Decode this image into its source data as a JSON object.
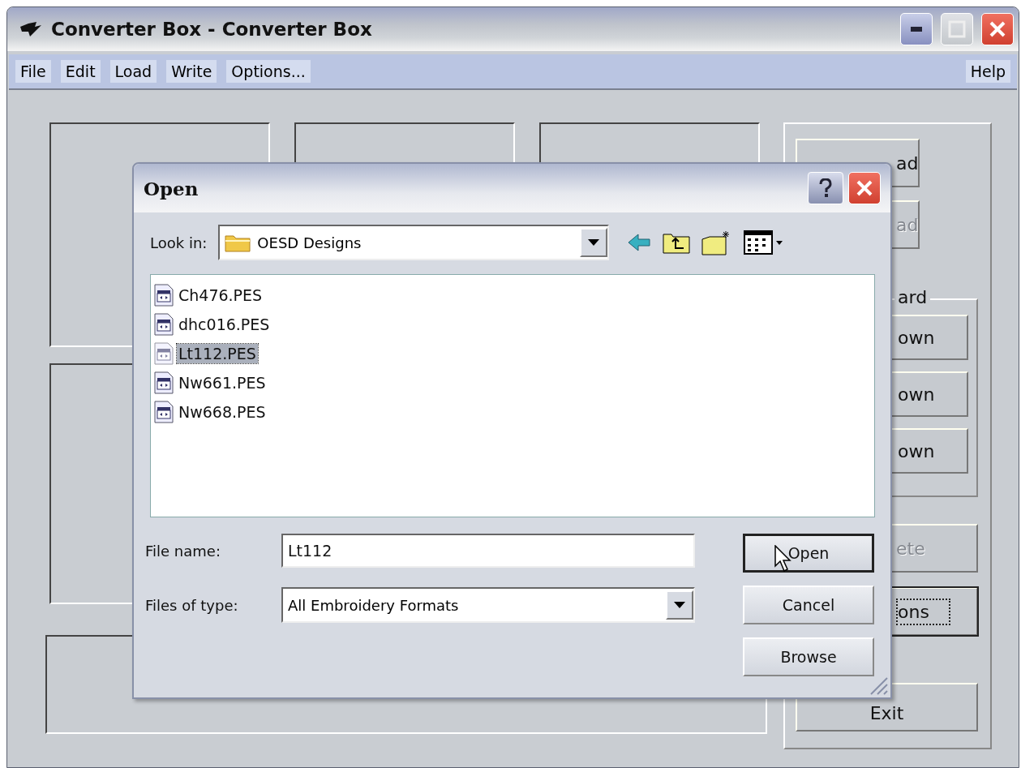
{
  "window": {
    "title": "Converter Box - Converter Box"
  },
  "menu": [
    {
      "label": "File"
    },
    {
      "label": "Edit"
    },
    {
      "label": "Load"
    },
    {
      "label": "Write"
    },
    {
      "label": "Options..."
    }
  ],
  "help_menu": {
    "label": "Help"
  },
  "side_buttons_top": [
    {
      "label": "ad",
      "disabled": false
    },
    {
      "label": "ad",
      "disabled": true
    }
  ],
  "group": {
    "label": "ard",
    "buttons": [
      {
        "label": "own",
        "disabled": false
      },
      {
        "label": "own",
        "disabled": false
      },
      {
        "label": "own",
        "disabled": false
      }
    ]
  },
  "side_buttons_bottom": [
    {
      "label": "ete",
      "disabled": true,
      "focused": false
    },
    {
      "label": "ons",
      "disabled": false,
      "focused": true
    }
  ],
  "exit_button": {
    "label": "Exit"
  },
  "dialog": {
    "title": "Open",
    "look_in_label": "Look in:",
    "look_in_value": "OESD Designs",
    "files": [
      {
        "name": "Ch476.PES",
        "selected": false
      },
      {
        "name": "dhc016.PES",
        "selected": false
      },
      {
        "name": "Lt112.PES",
        "selected": true
      },
      {
        "name": "Nw661.PES",
        "selected": false
      },
      {
        "name": "Nw668.PES",
        "selected": false
      }
    ],
    "file_name_label": "File name:",
    "file_name_value": "Lt112",
    "file_type_label": "Files of type:",
    "file_type_value": "All Embroidery Formats",
    "buttons": [
      {
        "label": "Open",
        "default": true
      },
      {
        "label": "Cancel",
        "default": false
      },
      {
        "label": "Browse",
        "default": false
      }
    ]
  }
}
